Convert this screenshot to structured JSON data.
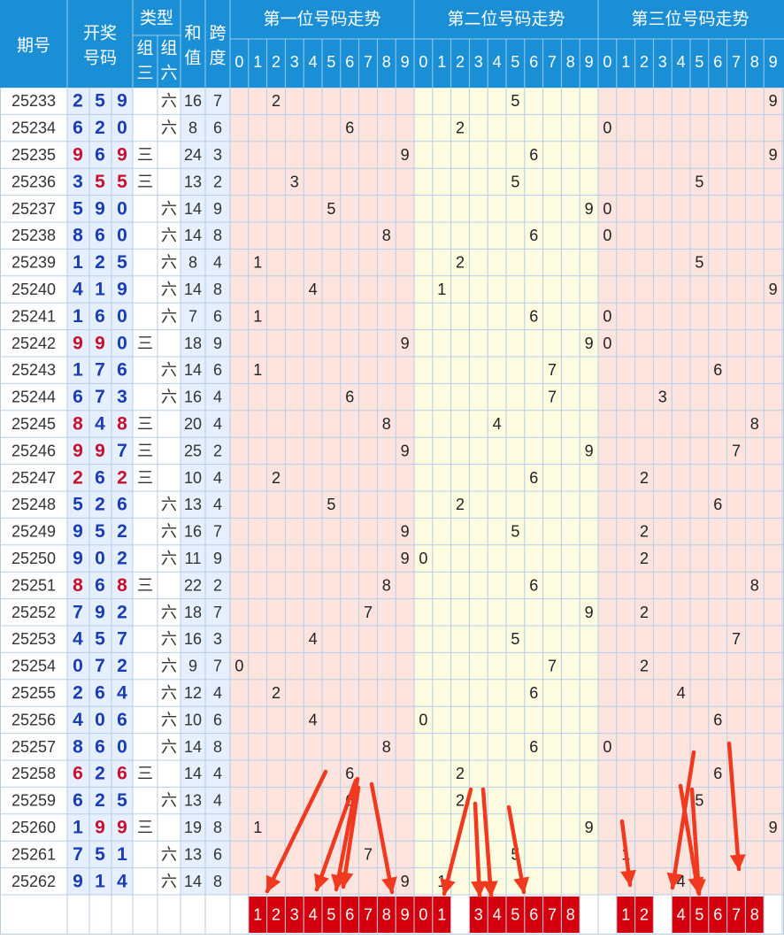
{
  "header": {
    "period": "期号",
    "draw_line1": "开奖",
    "draw_line2": "号码",
    "type": "类型",
    "g3a": "组",
    "g3b": "三",
    "g6a": "组",
    "g6b": "六",
    "sum_a": "和",
    "sum_b": "值",
    "span_a": "跨",
    "span_b": "度",
    "sections": [
      "第一位号码走势",
      "第二位号码走势",
      "第三位号码走势"
    ],
    "digits": [
      "0",
      "1",
      "2",
      "3",
      "4",
      "5",
      "6",
      "7",
      "8",
      "9"
    ]
  },
  "type_labels": {
    "z3": "三",
    "z6": "六"
  },
  "colors": {
    "header_bg": "#1a8fd6",
    "number_blue": "#1a3cb4",
    "number_red": "#c8102e",
    "pos1_bg": "#fde4df",
    "pos2_bg": "#fdfce0",
    "pos3_bg": "#fde4df",
    "col_bg": "#e6effd",
    "arrow_red": "#f0391e",
    "pick_box": "#d4000d"
  },
  "chart_data": {
    "type": "table",
    "title": "",
    "rows": [
      {
        "period": "25233",
        "nums": [
          2,
          5,
          9
        ],
        "type": "z6",
        "sum": 16,
        "span": 7
      },
      {
        "period": "25234",
        "nums": [
          6,
          2,
          0
        ],
        "type": "z6",
        "sum": 8,
        "span": 6
      },
      {
        "period": "25235",
        "nums": [
          9,
          6,
          9
        ],
        "type": "z3",
        "sum": 24,
        "span": 3
      },
      {
        "period": "25236",
        "nums": [
          3,
          5,
          5
        ],
        "type": "z3",
        "sum": 13,
        "span": 2
      },
      {
        "period": "25237",
        "nums": [
          5,
          9,
          0
        ],
        "type": "z6",
        "sum": 14,
        "span": 9
      },
      {
        "period": "25238",
        "nums": [
          8,
          6,
          0
        ],
        "type": "z6",
        "sum": 14,
        "span": 8
      },
      {
        "period": "25239",
        "nums": [
          1,
          2,
          5
        ],
        "type": "z6",
        "sum": 8,
        "span": 4
      },
      {
        "period": "25240",
        "nums": [
          4,
          1,
          9
        ],
        "type": "z6",
        "sum": 14,
        "span": 8
      },
      {
        "period": "25241",
        "nums": [
          1,
          6,
          0
        ],
        "type": "z6",
        "sum": 7,
        "span": 6
      },
      {
        "period": "25242",
        "nums": [
          9,
          9,
          0
        ],
        "type": "z3",
        "sum": 18,
        "span": 9
      },
      {
        "period": "25243",
        "nums": [
          1,
          7,
          6
        ],
        "type": "z6",
        "sum": 14,
        "span": 6
      },
      {
        "period": "25244",
        "nums": [
          6,
          7,
          3
        ],
        "type": "z6",
        "sum": 16,
        "span": 4
      },
      {
        "period": "25245",
        "nums": [
          8,
          4,
          8
        ],
        "type": "z3",
        "sum": 20,
        "span": 4
      },
      {
        "period": "25246",
        "nums": [
          9,
          9,
          7
        ],
        "type": "z3",
        "sum": 25,
        "span": 2
      },
      {
        "period": "25247",
        "nums": [
          2,
          6,
          2
        ],
        "type": "z3",
        "sum": 10,
        "span": 4
      },
      {
        "period": "25248",
        "nums": [
          5,
          2,
          6
        ],
        "type": "z6",
        "sum": 13,
        "span": 4
      },
      {
        "period": "25249",
        "nums": [
          9,
          5,
          2
        ],
        "type": "z6",
        "sum": 16,
        "span": 7
      },
      {
        "period": "25250",
        "nums": [
          9,
          0,
          2
        ],
        "type": "z6",
        "sum": 11,
        "span": 9
      },
      {
        "period": "25251",
        "nums": [
          8,
          6,
          8
        ],
        "type": "z3",
        "sum": 22,
        "span": 2
      },
      {
        "period": "25252",
        "nums": [
          7,
          9,
          2
        ],
        "type": "z6",
        "sum": 18,
        "span": 7
      },
      {
        "period": "25253",
        "nums": [
          4,
          5,
          7
        ],
        "type": "z6",
        "sum": 16,
        "span": 3
      },
      {
        "period": "25254",
        "nums": [
          0,
          7,
          2
        ],
        "type": "z6",
        "sum": 9,
        "span": 7
      },
      {
        "period": "25255",
        "nums": [
          2,
          6,
          4
        ],
        "type": "z6",
        "sum": 12,
        "span": 4
      },
      {
        "period": "25256",
        "nums": [
          4,
          0,
          6
        ],
        "type": "z6",
        "sum": 10,
        "span": 6
      },
      {
        "period": "25257",
        "nums": [
          8,
          6,
          0
        ],
        "type": "z6",
        "sum": 14,
        "span": 8
      },
      {
        "period": "25258",
        "nums": [
          6,
          2,
          6
        ],
        "type": "z3",
        "sum": 14,
        "span": 4
      },
      {
        "period": "25259",
        "nums": [
          6,
          2,
          5
        ],
        "type": "z6",
        "sum": 13,
        "span": 4
      },
      {
        "period": "25260",
        "nums": [
          1,
          9,
          9
        ],
        "type": "z3",
        "sum": 19,
        "span": 8
      },
      {
        "period": "25261",
        "nums": [
          7,
          5,
          1
        ],
        "type": "z6",
        "sum": 13,
        "span": 6
      },
      {
        "period": "25262",
        "nums": [
          9,
          1,
          4
        ],
        "type": "z6",
        "sum": 14,
        "span": 8
      }
    ],
    "picks": [
      [
        "1",
        "2",
        "3",
        "4",
        "5",
        "6",
        "7",
        "8",
        "9"
      ],
      [
        "0",
        "1",
        "3",
        "4",
        "5",
        "6",
        "7",
        "8"
      ],
      [
        "1",
        "2",
        "4",
        "5",
        "6",
        "7",
        "8"
      ]
    ]
  }
}
